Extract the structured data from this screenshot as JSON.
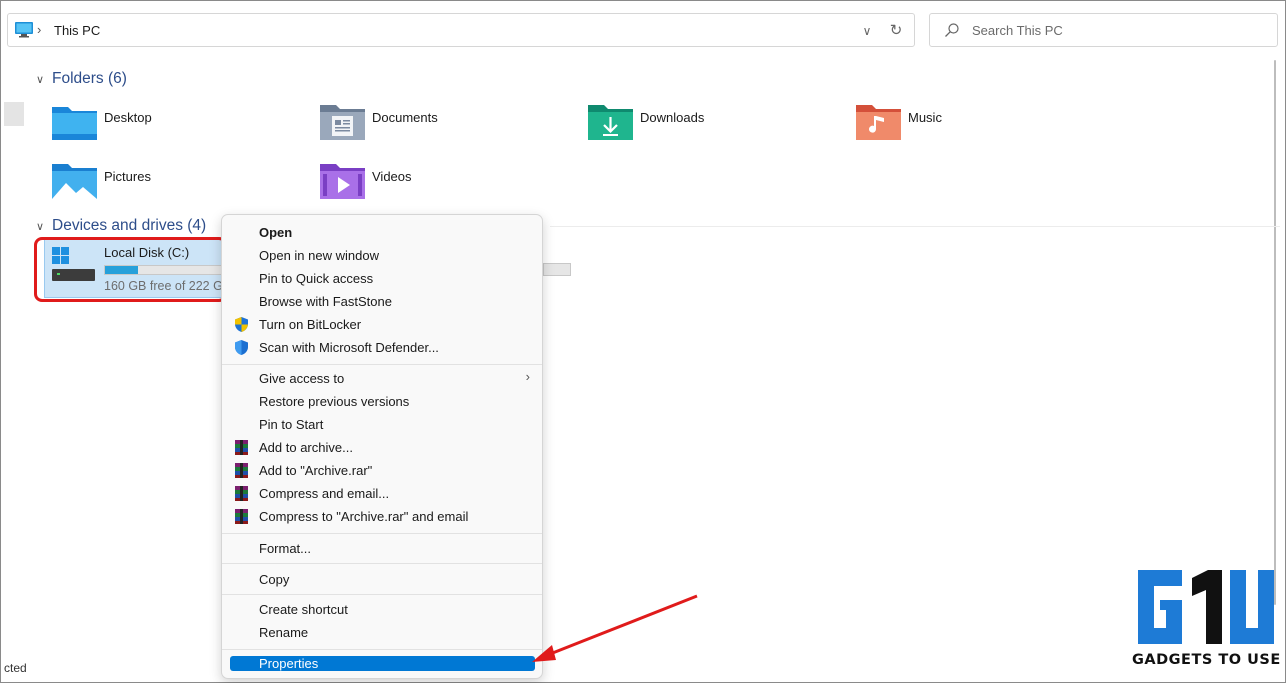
{
  "address_bar": {
    "location": "This PC",
    "separator": "›"
  },
  "search": {
    "placeholder": "Search This PC"
  },
  "folders_section": {
    "title": "Folders (6)",
    "items": [
      {
        "label": "Desktop",
        "icon": "desktop-folder-icon"
      },
      {
        "label": "Documents",
        "icon": "documents-folder-icon"
      },
      {
        "label": "Downloads",
        "icon": "downloads-folder-icon"
      },
      {
        "label": "Music",
        "icon": "music-folder-icon"
      },
      {
        "label": "Pictures",
        "icon": "pictures-folder-icon"
      },
      {
        "label": "Videos",
        "icon": "videos-folder-icon"
      }
    ]
  },
  "drives_section": {
    "title": "Devices and drives (4)",
    "drive": {
      "label": "Local Disk (C:)",
      "free_text": "160 GB free of 222 GB",
      "used_fraction": 0.279
    }
  },
  "context_menu": {
    "items": [
      {
        "label": "Open"
      },
      {
        "label": "Open in new window"
      },
      {
        "label": "Pin to Quick access"
      },
      {
        "label": "Browse with FastStone"
      },
      {
        "label": "Turn on BitLocker",
        "icon": "bitlocker-shield-icon"
      },
      {
        "label": "Scan with Microsoft Defender...",
        "icon": "defender-shield-icon"
      },
      {
        "label": "Give access to",
        "submenu": "›"
      },
      {
        "label": "Restore previous versions"
      },
      {
        "label": "Pin to Start"
      },
      {
        "label": "Add to archive...",
        "icon": "winrar-icon"
      },
      {
        "label": "Add to \"Archive.rar\"",
        "icon": "winrar-icon"
      },
      {
        "label": "Compress and email...",
        "icon": "winrar-icon"
      },
      {
        "label": "Compress to \"Archive.rar\" and email",
        "icon": "winrar-icon"
      },
      {
        "label": "Format..."
      },
      {
        "label": "Copy"
      },
      {
        "label": "Create shortcut"
      },
      {
        "label": "Rename"
      },
      {
        "label": "Properties"
      }
    ]
  },
  "status_bar": {
    "text": "cted"
  },
  "watermark": {
    "text": "GADGETS TO USE"
  },
  "colors": {
    "accent": "#0078d4",
    "highlight_red": "#e01b1b",
    "section_header": "#2d4d8a",
    "selection_bg": "#cce4f7"
  }
}
